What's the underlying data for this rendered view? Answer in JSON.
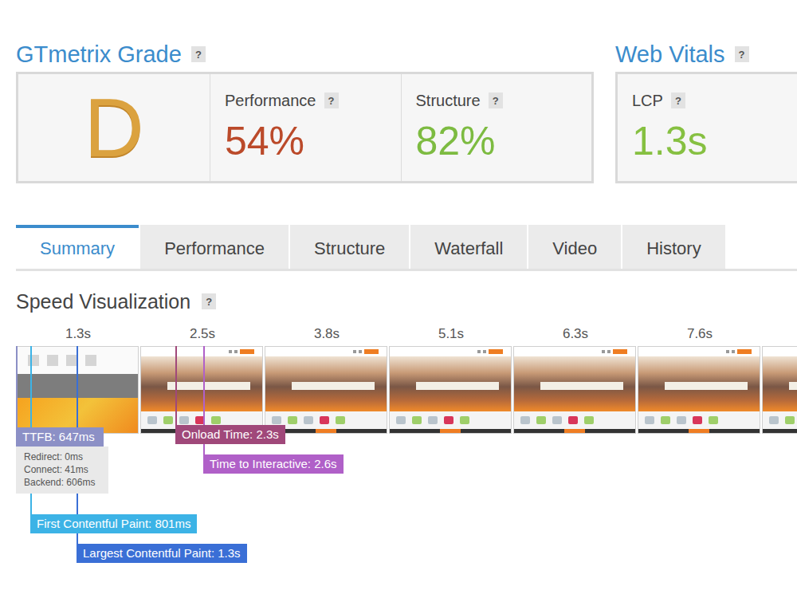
{
  "grade": {
    "title": "GTmetrix Grade",
    "help": "?",
    "letter": "D",
    "metrics": [
      {
        "label": "Performance",
        "help": "?",
        "value": "54%",
        "color": "#bb4a2a"
      },
      {
        "label": "Structure",
        "help": "?",
        "value": "82%",
        "color": "#7dbb41"
      }
    ]
  },
  "web_vitals": {
    "title": "Web Vitals",
    "help": "?",
    "metrics": [
      {
        "label": "LCP",
        "help": "?",
        "value": "1.3s",
        "color": "#86c041"
      }
    ]
  },
  "tabs": [
    {
      "label": "Summary",
      "selected": true
    },
    {
      "label": "Performance",
      "selected": false
    },
    {
      "label": "Structure",
      "selected": false
    },
    {
      "label": "Waterfall",
      "selected": false
    },
    {
      "label": "Video",
      "selected": false
    },
    {
      "label": "History",
      "selected": false
    }
  ],
  "speed_visualization": {
    "title": "Speed Visualization",
    "help": "?",
    "ticks": [
      "1.3s",
      "2.5s",
      "3.8s",
      "5.1s",
      "6.3s",
      "7.6s"
    ],
    "frames": [
      {
        "kind": "partial"
      },
      {
        "kind": "loaded"
      },
      {
        "kind": "loaded"
      },
      {
        "kind": "loaded"
      },
      {
        "kind": "loaded"
      },
      {
        "kind": "loaded"
      },
      {
        "kind": "loaded"
      }
    ],
    "markers": [
      {
        "kind": "ttfb",
        "label": "TTFB: 647ms",
        "color": "#8c90c6",
        "details": [
          "Redirect: 0ms",
          "Connect: 41ms",
          "Backend: 606ms"
        ]
      },
      {
        "kind": "onload",
        "label": "Onload Time: 2.3s",
        "color": "#a0487a",
        "details": []
      },
      {
        "kind": "tti",
        "label": "Time to Interactive: 2.6s",
        "color": "#b060c8",
        "details": []
      },
      {
        "kind": "fcp",
        "label": "First Contentful Paint: 801ms",
        "color": "#3cb3e6",
        "details": []
      },
      {
        "kind": "lcp",
        "label": "Largest Contentful Paint: 1.3s",
        "color": "#3a6fd6",
        "details": []
      }
    ]
  }
}
